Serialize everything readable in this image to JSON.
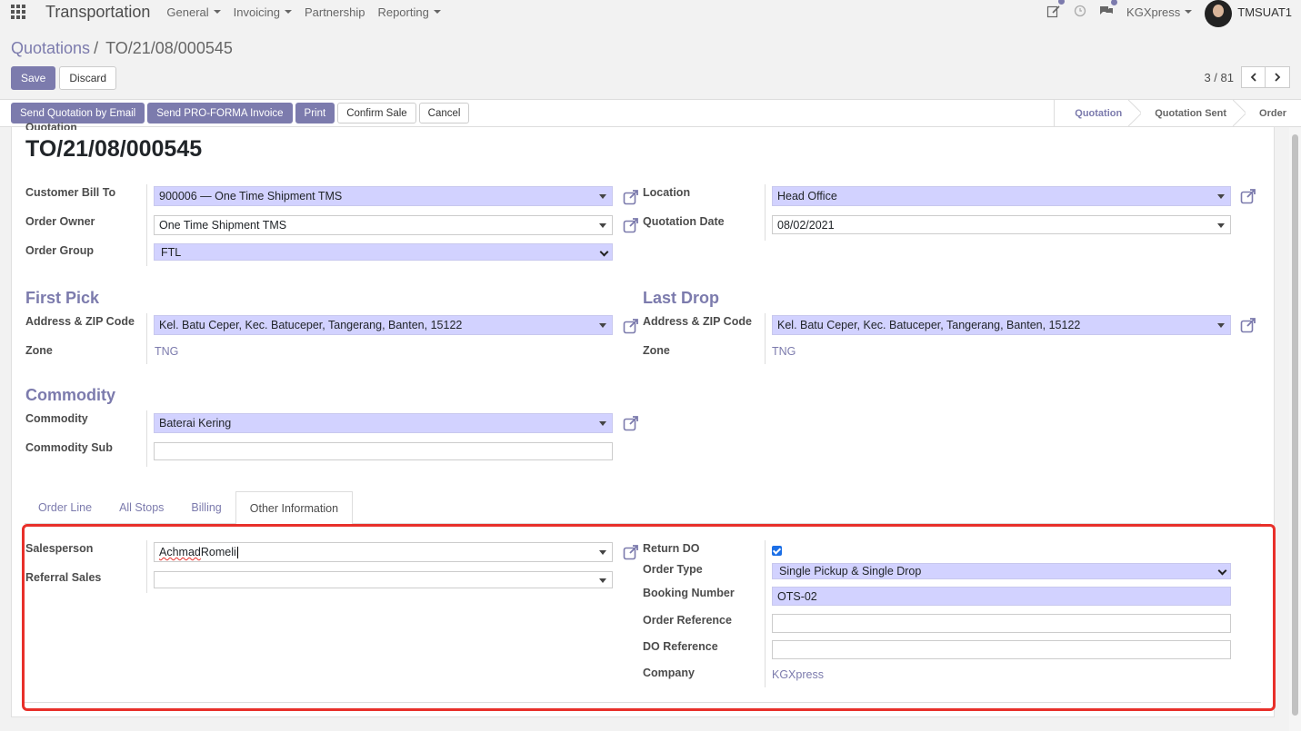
{
  "nav": {
    "app_title": "Transportation",
    "menus": [
      "General",
      "Invoicing",
      "Partnership",
      "Reporting"
    ],
    "company": "KGXpress",
    "user": "TMSUAT1"
  },
  "breadcrumb": {
    "parent": "Quotations",
    "current": "TO/21/08/000545"
  },
  "buttons": {
    "save": "Save",
    "discard": "Discard"
  },
  "pager": {
    "value": "3 / 81"
  },
  "actions": [
    "Send Quotation by Email",
    "Send PRO-FORMA Invoice",
    "Print",
    "Confirm Sale",
    "Cancel"
  ],
  "stages": [
    "Quotation",
    "Quotation Sent",
    "Order"
  ],
  "doc": {
    "label": "Quotation",
    "title": "TO/21/08/000545"
  },
  "header_fields": {
    "customer_bill_to": {
      "label": "Customer Bill To",
      "value": "900006 — One Time Shipment TMS"
    },
    "order_owner": {
      "label": "Order Owner",
      "value": "One Time Shipment TMS"
    },
    "order_group": {
      "label": "Order Group",
      "value": "FTL"
    },
    "location": {
      "label": "Location",
      "value": "Head Office"
    },
    "quotation_date": {
      "label": "Quotation Date",
      "value": "08/02/2021"
    }
  },
  "first_pick": {
    "title": "First Pick",
    "address_label": "Address & ZIP Code",
    "address": "Kel. Batu Ceper, Kec. Batuceper, Tangerang, Banten, 15122",
    "zone_label": "Zone",
    "zone": "TNG"
  },
  "last_drop": {
    "title": "Last Drop",
    "address_label": "Address & ZIP Code",
    "address": "Kel. Batu Ceper, Kec. Batuceper, Tangerang, Banten, 15122",
    "zone_label": "Zone",
    "zone": "TNG"
  },
  "commodity": {
    "title": "Commodity",
    "commodity_label": "Commodity",
    "commodity": "Baterai Kering",
    "sub_label": "Commodity Sub",
    "sub": ""
  },
  "tabs": [
    "Order Line",
    "All Stops",
    "Billing",
    "Other Information"
  ],
  "other_info": {
    "salesperson_label": "Salesperson",
    "salesperson_first": "Achmad",
    "salesperson_last": " Romeli",
    "referral_label": "Referral Sales",
    "referral": "",
    "return_do_label": "Return DO",
    "return_do": true,
    "order_type_label": "Order Type",
    "order_type": "Single Pickup & Single Drop",
    "booking_label": "Booking Number",
    "booking": "OTS-02",
    "order_ref_label": "Order Reference",
    "order_ref": "",
    "do_ref_label": "DO Reference",
    "do_ref": "",
    "company_label": "Company",
    "company": "KGXpress"
  },
  "colors": {
    "accent": "#7c7bad",
    "required_bg": "#d2d2ff",
    "highlight": "#e8302a"
  }
}
